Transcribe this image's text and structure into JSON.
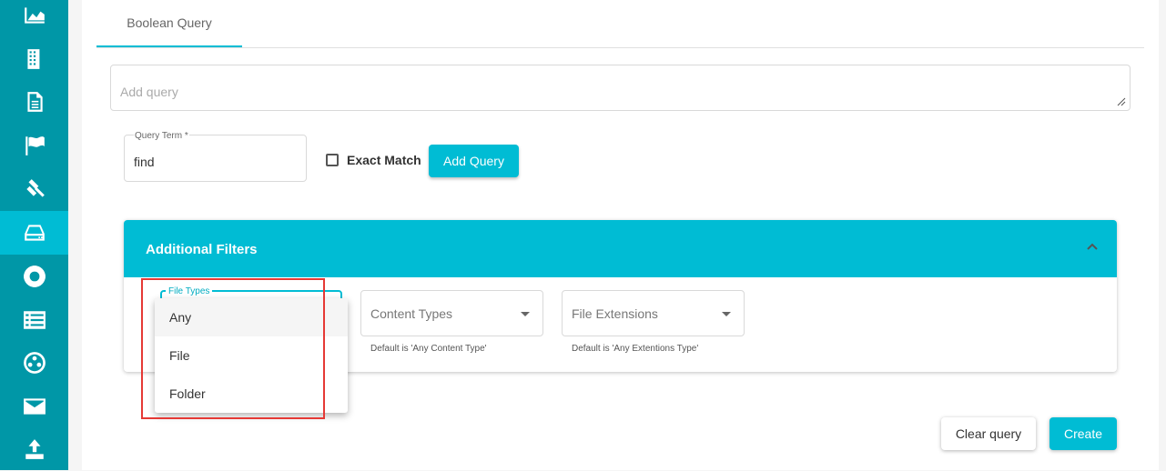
{
  "colors": {
    "sidebar": "#0097a7",
    "sidebar_active": "#00bcd4",
    "accent": "#00bcd4",
    "highlight": "#e53935"
  },
  "sidebar": {
    "items": [
      {
        "icon": "area-chart-icon"
      },
      {
        "icon": "building-icon"
      },
      {
        "icon": "document-icon"
      },
      {
        "icon": "flag-icon"
      },
      {
        "icon": "gavel-icon"
      },
      {
        "icon": "storage-drive-icon",
        "active": true
      },
      {
        "icon": "lifebuoy-icon"
      },
      {
        "icon": "list-view-icon"
      },
      {
        "icon": "network-icon"
      },
      {
        "icon": "mail-icon"
      },
      {
        "icon": "upload-icon"
      }
    ]
  },
  "tabs": [
    {
      "label": "Boolean Query",
      "active": true
    }
  ],
  "query": {
    "placeholder": "Add query"
  },
  "term": {
    "label": "Query Term *",
    "value": "find"
  },
  "exact_match": {
    "label": "Exact Match",
    "checked": false
  },
  "add_query_button": "Add Query",
  "filters": {
    "title": "Additional Filters",
    "file_types": {
      "label": "File Types",
      "options": [
        "Any",
        "File",
        "Folder"
      ],
      "selected": "Any"
    },
    "content_types": {
      "placeholder": "Content Types",
      "helper": "Default is 'Any Content Type'"
    },
    "file_extensions": {
      "placeholder": "File Extensions",
      "helper": "Default is 'Any Extentions Type'"
    }
  },
  "actions": {
    "clear": "Clear query",
    "create": "Create"
  }
}
